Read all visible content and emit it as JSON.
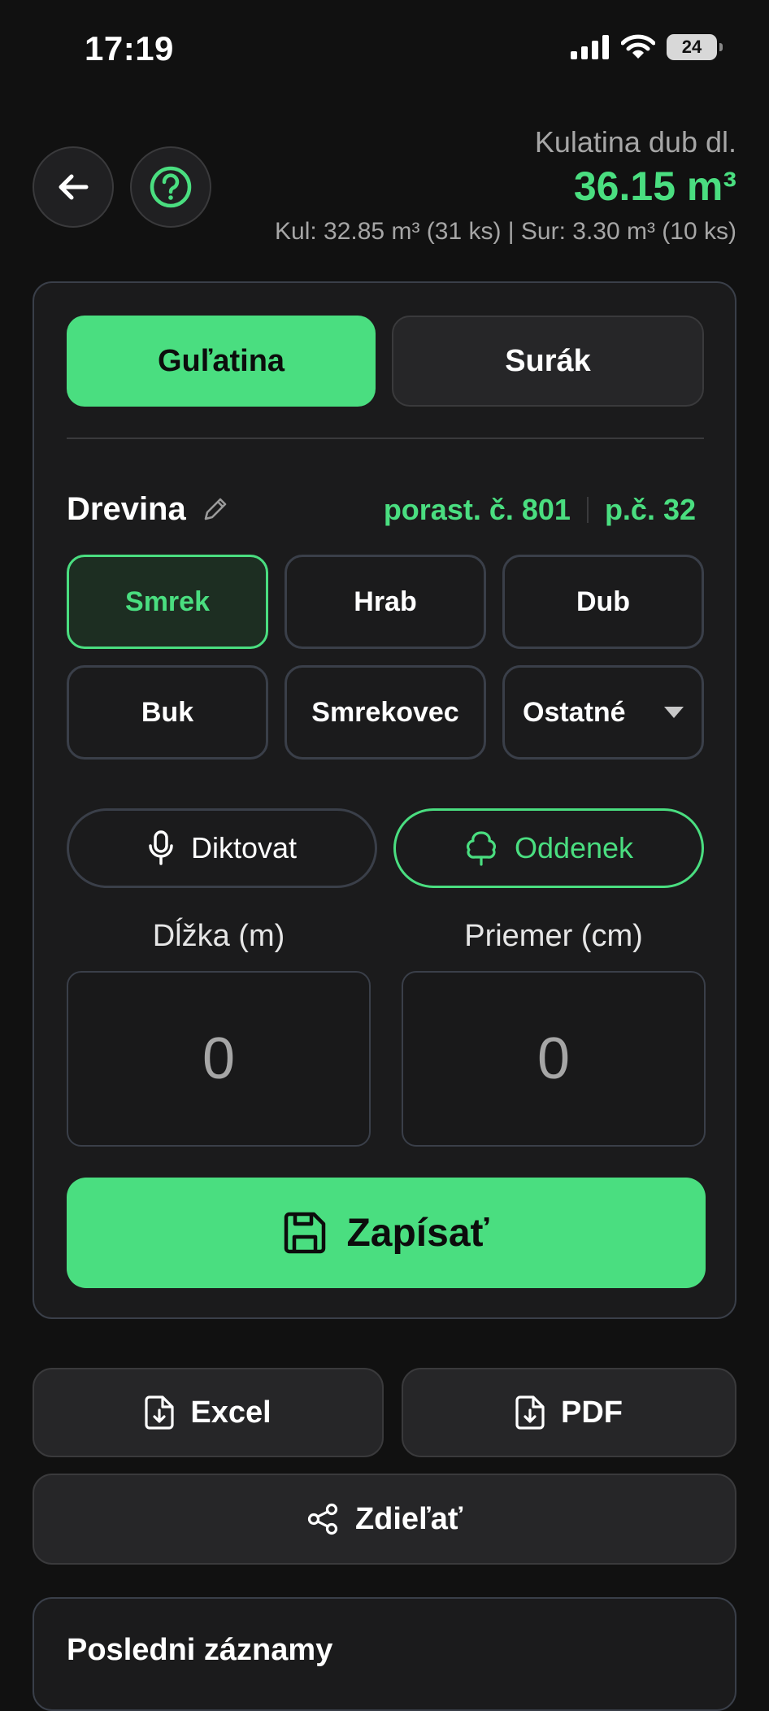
{
  "status_bar": {
    "time": "17:19",
    "battery": "24"
  },
  "header": {
    "subtitle": "Kulatina dub dl.",
    "total": "36.15 m³",
    "stats": "Kul: 32.85 m³ (31 ks) | Sur: 3.30 m³ (10 ks)"
  },
  "tabs": {
    "round": "Guľatina",
    "raw": "Surák"
  },
  "species_section": {
    "label": "Drevina",
    "stand": "porast. č. 801",
    "plot": "p.č. 32",
    "items": [
      "Smrek",
      "Hrab",
      "Dub",
      "Buk",
      "Smrekovec",
      "Ostatné"
    ],
    "selected": "Smrek"
  },
  "actions": {
    "dictate": "Diktovat",
    "stump": "Oddenek"
  },
  "inputs": {
    "length_label": "Dĺžka (m)",
    "length_value": "0",
    "diameter_label": "Priemer (cm)",
    "diameter_value": "0"
  },
  "save_label": "Zapísať",
  "export": {
    "excel": "Excel",
    "pdf": "PDF",
    "share": "Zdieľať"
  },
  "recent": {
    "title": "Posledni záznamy"
  },
  "colors": {
    "accent": "#4ade80",
    "background": "#111111",
    "card": "#1b1b1c"
  }
}
